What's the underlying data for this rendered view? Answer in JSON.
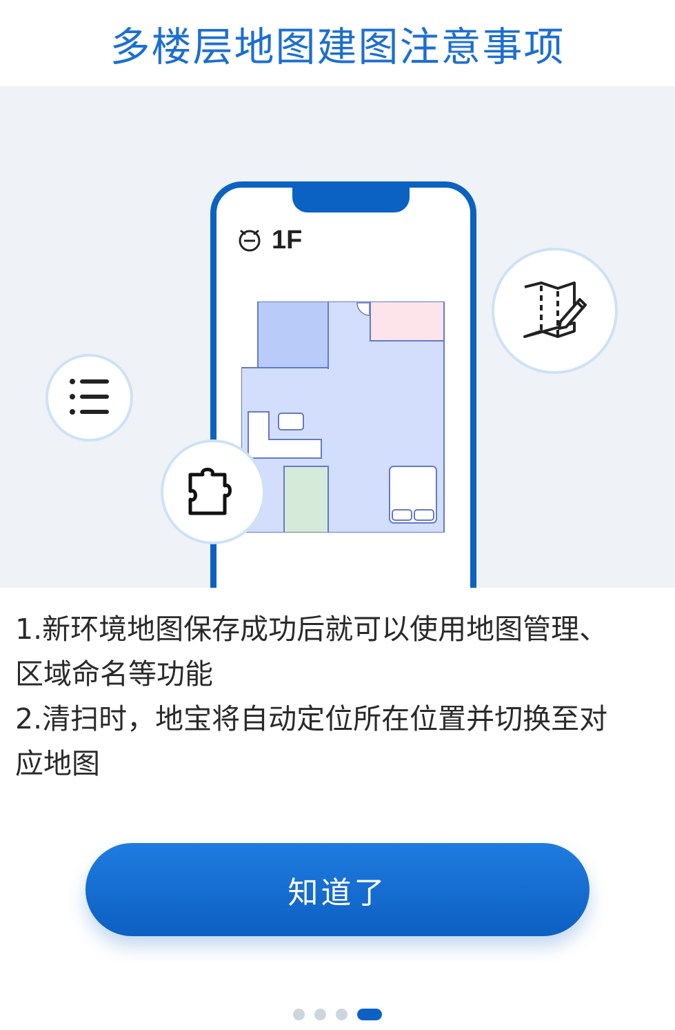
{
  "dialog": {
    "title": "多楼层地图建图注意事项"
  },
  "illustration": {
    "floor_label": "1F",
    "icons": [
      "robot-icon",
      "list-icon",
      "map-edit-icon",
      "puzzle-icon"
    ],
    "colors": {
      "phone_frame": "#0b62c2",
      "room_blue_dark": "#b9cbf9",
      "room_blue_light": "#d3defc",
      "room_pink": "#fde4ea",
      "room_green": "#d5ead8",
      "bubble_border": "#cde2f7"
    }
  },
  "content": {
    "line1": "1.新环境地图保存成功后就可以使用地图管理、",
    "line2": "区域命名等功能",
    "line3": "2.清扫时，地宝将自动定位所在位置并切换至对",
    "line4": "应地图"
  },
  "actions": {
    "confirm_label": "知道了"
  },
  "pagination": {
    "total": 4,
    "current": 4
  }
}
